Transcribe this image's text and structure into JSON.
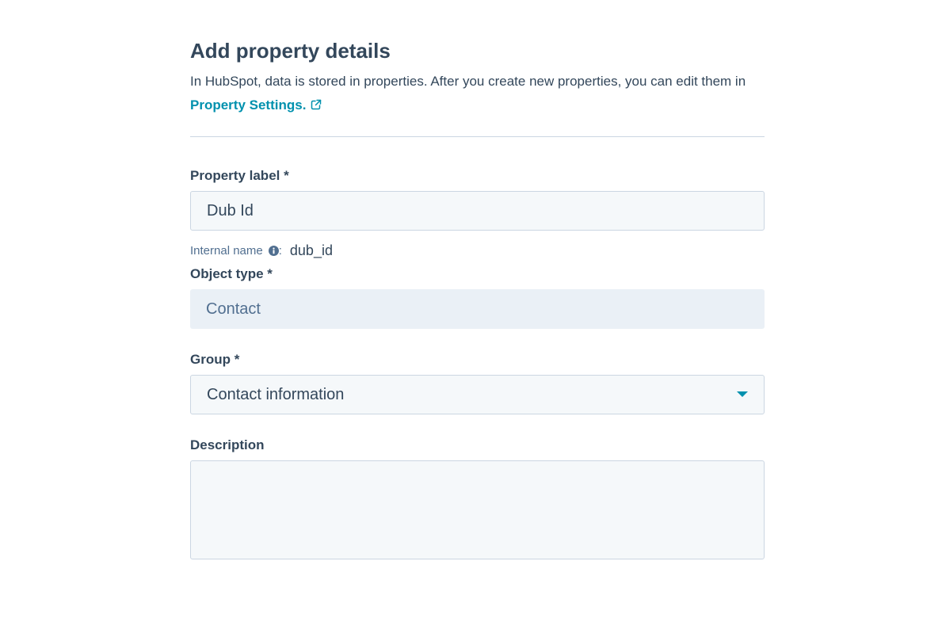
{
  "header": {
    "title": "Add property details",
    "intro_text": "In HubSpot, data is stored in properties. After you create new properties, you can edit them in ",
    "intro_link": "Property Settings.",
    "link_icon": "external-link-icon"
  },
  "form": {
    "property_label": {
      "label": "Property label *",
      "value": "Dub Id"
    },
    "internal_name": {
      "label": "Internal name",
      "icon": "info-icon",
      "separator": ":",
      "value": "dub_id"
    },
    "object_type": {
      "label": "Object type *",
      "value": "Contact"
    },
    "group": {
      "label": "Group *",
      "selected": "Contact information",
      "icon": "caret-down-icon"
    },
    "description": {
      "label": "Description",
      "value": ""
    }
  },
  "colors": {
    "text": "#33475b",
    "link": "#0091ae",
    "input_bg": "#f5f8fa",
    "readonly_bg": "#eaf0f6",
    "border": "#cbd6e2"
  }
}
